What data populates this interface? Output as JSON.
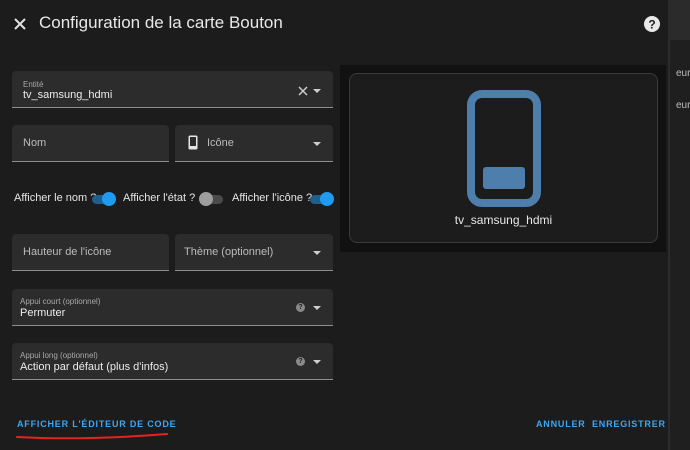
{
  "background": {
    "behind_lines": [
      "eure",
      "eure"
    ]
  },
  "dialog": {
    "title": "Configuration de la carte Bouton",
    "icons": {
      "close": "close-icon",
      "help": "help-circle-icon"
    }
  },
  "form": {
    "entity": {
      "label": "Entité",
      "value": "tv_samsung_hdmi"
    },
    "name": {
      "placeholder": "Nom"
    },
    "icon": {
      "placeholder": "Icône",
      "icon": "cellphone-icon"
    },
    "toggles": [
      {
        "label": "Afficher le nom ?",
        "on": true
      },
      {
        "label": "Afficher l'état ?",
        "on": false
      },
      {
        "label": "Afficher l'icône ?",
        "on": true
      }
    ],
    "icon_height": {
      "placeholder": "Hauteur de l'icône"
    },
    "theme": {
      "placeholder": "Thème (optionnel)"
    },
    "tap_action": {
      "label": "Appui court (optionnel)",
      "value": "Permuter"
    },
    "hold_action": {
      "label": "Appui long (optionnel)",
      "value": "Action par défaut (plus d'infos)"
    }
  },
  "preview": {
    "entity_name": "tv_samsung_hdmi",
    "icon": "cellphone-icon",
    "icon_color": "#4e7eab"
  },
  "footer": {
    "show_code_editor": "AFFICHER L'ÉDITEUR DE CODE",
    "cancel": "ANNULER",
    "save": "ENREGISTRER"
  },
  "colors": {
    "accent": "#3ea6f0",
    "annotation": "#e8221f"
  }
}
